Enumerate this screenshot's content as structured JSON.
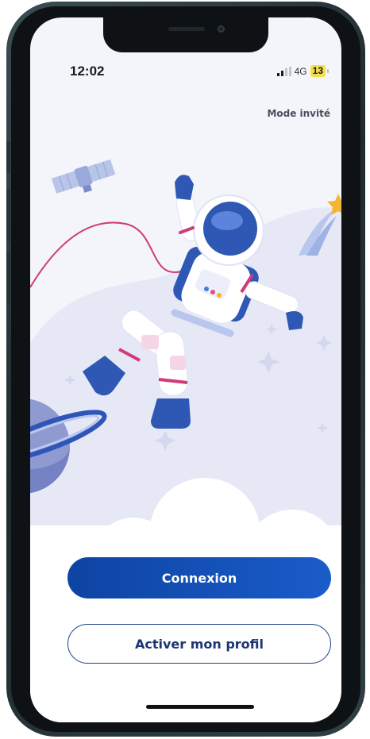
{
  "status_bar": {
    "time": "12:02",
    "network": "4G",
    "battery": "13"
  },
  "header": {
    "guest_mode_label": "Mode invité"
  },
  "actions": {
    "login_label": "Connexion",
    "activate_profile_label": "Activer mon profil"
  },
  "colors": {
    "primary": "#0e44a3",
    "primary_end": "#1a5cc9",
    "outline": "#1b3f86",
    "background": "#f4f5fb",
    "battery_low": "#f6e04a"
  },
  "illustration": {
    "icons": [
      "satellite-icon",
      "astronaut-icon",
      "planet-icon",
      "shooting-star-icon",
      "sparkle-star-icon",
      "cloud-icon"
    ]
  }
}
